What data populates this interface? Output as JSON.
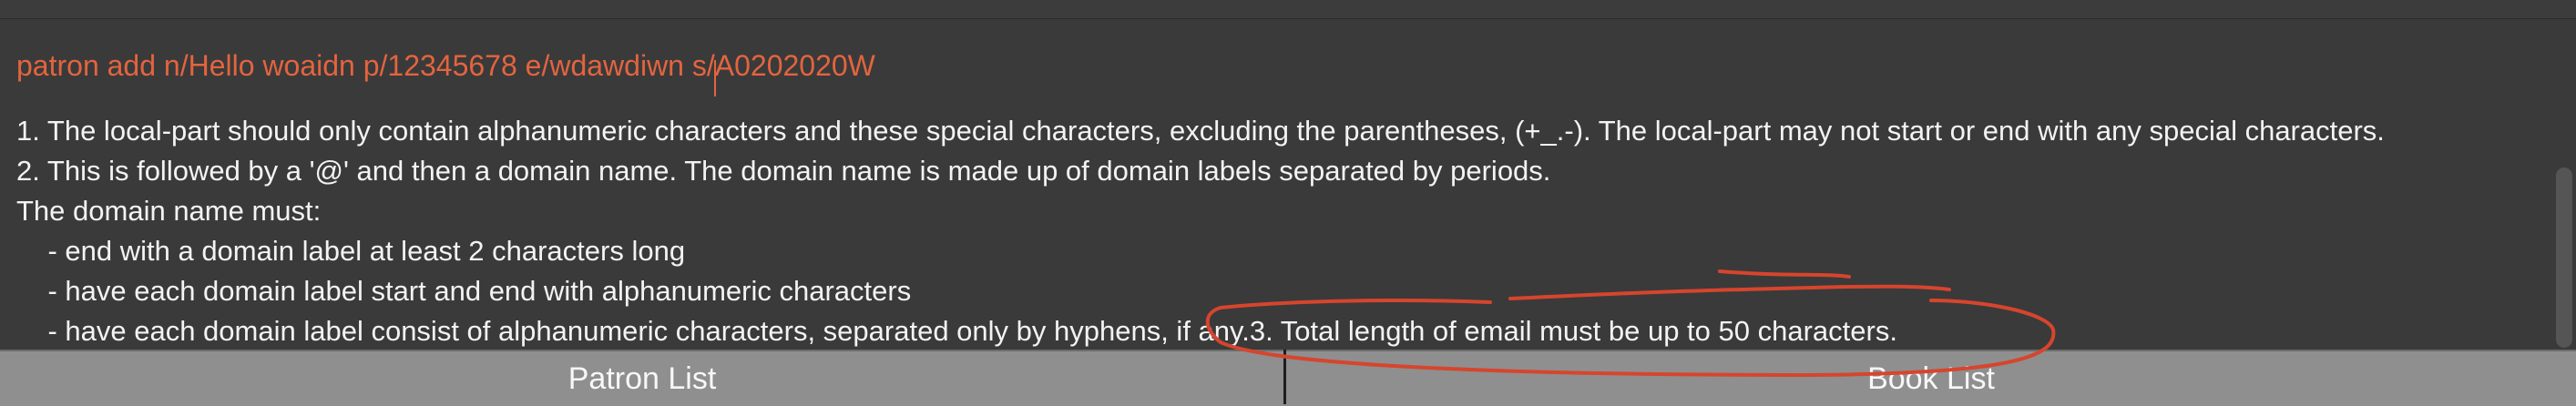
{
  "command": {
    "text": "patron add n/Hello woaidn p/12345678 e/wdawdiwn s/A0202020W",
    "color": "#e3643f"
  },
  "result": {
    "lines": [
      "1. The local-part should only contain alphanumeric characters and these special characters, excluding the parentheses, (+_.-). The local-part may not start or end with any special characters.",
      "2. This is followed by a '@' and then a domain name. The domain name is made up of domain labels separated by periods.",
      "The domain name must:",
      "    - end with a domain label at least 2 characters long",
      "    - have each domain label start and end with alphanumeric characters",
      "    - have each domain label consist of alphanumeric characters, separated only by hyphens, if any.3. Total length of email must be up to 50 characters."
    ]
  },
  "tabs": {
    "patron_label": "Patron List",
    "book_label": "Book List"
  },
  "annotation": {
    "color": "#d6452d"
  }
}
